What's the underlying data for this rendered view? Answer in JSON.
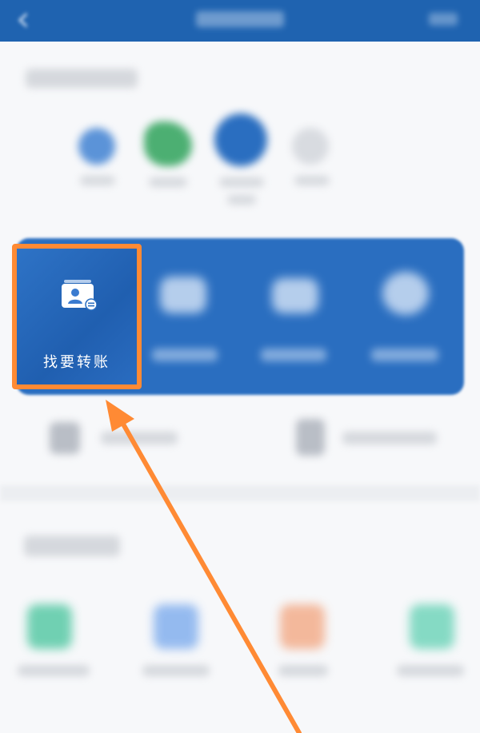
{
  "header": {
    "back_icon": "back-chevron-icon",
    "title_blurred": true
  },
  "quick_actions": {
    "highlighted_item": {
      "label": "找要转账",
      "icon": "contact-card-transfer-icon"
    }
  },
  "annotation": {
    "highlight_color": "#ff8a34",
    "arrow_color": "#ff8a34"
  },
  "colors": {
    "header_blue": "#1f63b0",
    "card_blue": "#2a6ec0",
    "background": "#f7f8fa"
  }
}
